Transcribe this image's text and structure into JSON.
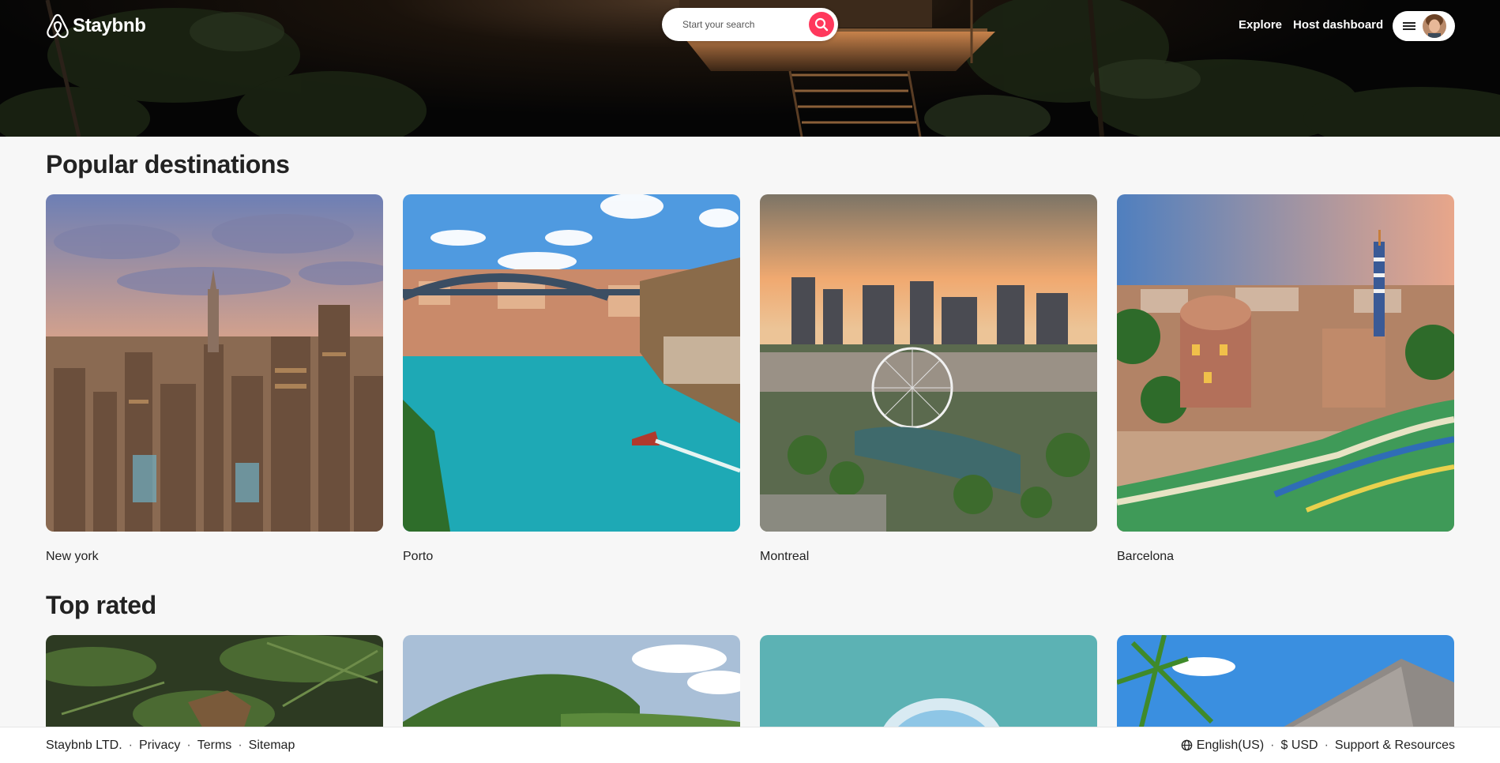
{
  "header": {
    "brand": "Staybnb",
    "search_placeholder": "Start your search",
    "nav": [
      "Explore",
      "Host dashboard"
    ]
  },
  "popular": {
    "title": "Popular destinations",
    "items": [
      {
        "label": "New york"
      },
      {
        "label": "Porto"
      },
      {
        "label": "Montreal"
      },
      {
        "label": "Barcelona"
      }
    ]
  },
  "top_rated": {
    "title": "Top rated"
  },
  "footer": {
    "company": "Staybnb LTD.",
    "links": [
      "Privacy",
      "Terms",
      "Sitemap"
    ],
    "language": "English(US)",
    "currency": "$ USD",
    "support": "Support & Resources",
    "separator": "·"
  },
  "colors": {
    "accent": "#ff385c",
    "background": "#f7f7f7"
  }
}
